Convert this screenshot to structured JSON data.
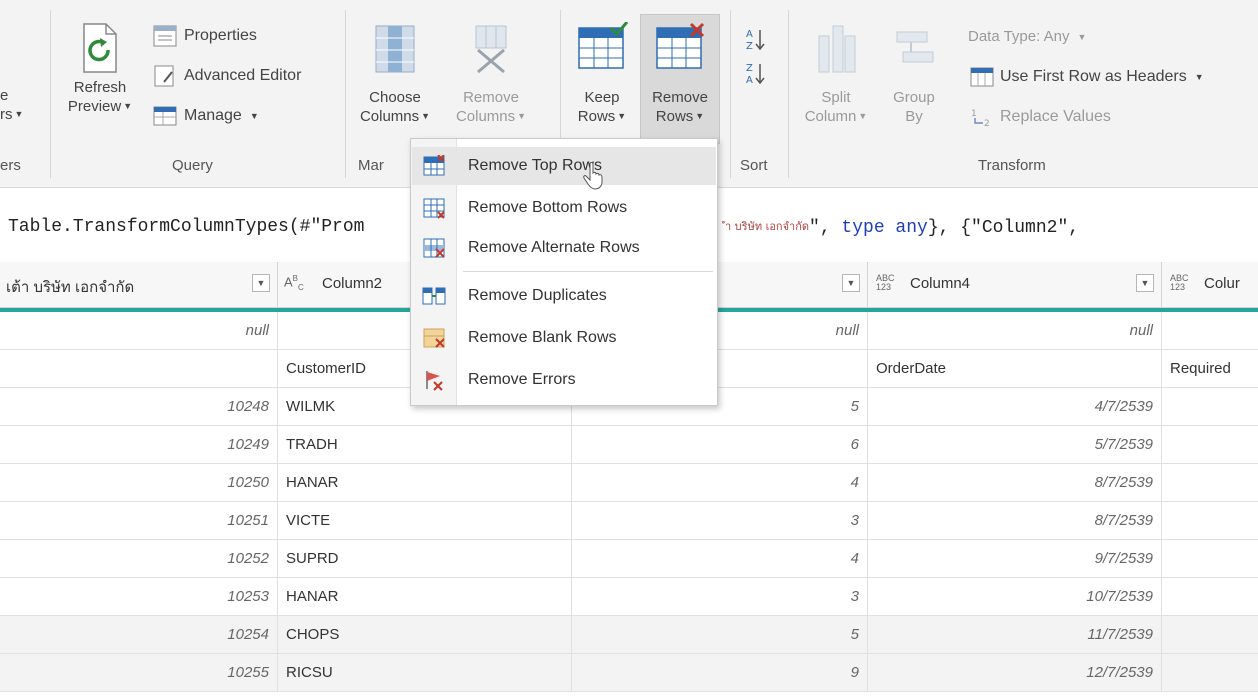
{
  "ribbon": {
    "left_cut_1": "e",
    "left_cut_2": "rs",
    "left_cut_group": "ers",
    "refresh_line1": "Refresh",
    "refresh_line2": "Preview",
    "properties": "Properties",
    "advanced_editor": "Advanced Editor",
    "manage": "Manage",
    "query_group": "Query",
    "choose_line1": "Choose",
    "choose_line2": "Columns",
    "remove_cols_line1": "Remove",
    "remove_cols_line2": "Columns",
    "manage_group_cut": "Mar",
    "keep_line1": "Keep",
    "keep_line2": "Rows",
    "remove_rows_line1": "Remove",
    "remove_rows_line2": "Rows",
    "sort_group": "Sort",
    "split_line1": "Split",
    "split_line2": "Column",
    "group_line1": "Group",
    "group_line2": "By",
    "data_type": "Data Type: Any",
    "first_row_headers": "Use First Row as Headers",
    "replace_values": "Replace Values",
    "transform_group": "Transform"
  },
  "formula": {
    "left": "Table.TransformColumnTypes(#\"Prom",
    "right_thai": "ำ บริษัท เอกจำกัด",
    "right_mid": "\", ",
    "right_kw": "type any",
    "right_end": "}, {\"Column2\","
  },
  "menu": {
    "items": [
      {
        "label": "Remove Top Rows"
      },
      {
        "label": "Remove Bottom Rows"
      },
      {
        "label": "Remove Alternate Rows"
      },
      {
        "label": "Remove Duplicates"
      },
      {
        "label": "Remove Blank Rows"
      },
      {
        "label": "Remove Errors"
      }
    ]
  },
  "grid": {
    "columns": {
      "col1": "เต้า บริษัท เอกจำกัด",
      "col2": "Column2",
      "col4": "Column4",
      "col5_cut": "Colur"
    },
    "null_text": "null",
    "header_row": {
      "col2": "CustomerID",
      "col4": "OrderDate",
      "col5": "Required"
    },
    "rows": [
      {
        "id": "10248",
        "cust": "WILMK",
        "n": "5",
        "date": "4/7/2539"
      },
      {
        "id": "10249",
        "cust": "TRADH",
        "n": "6",
        "date": "5/7/2539"
      },
      {
        "id": "10250",
        "cust": "HANAR",
        "n": "4",
        "date": "8/7/2539"
      },
      {
        "id": "10251",
        "cust": "VICTE",
        "n": "3",
        "date": "8/7/2539"
      },
      {
        "id": "10252",
        "cust": "SUPRD",
        "n": "4",
        "date": "9/7/2539"
      },
      {
        "id": "10253",
        "cust": "HANAR",
        "n": "3",
        "date": "10/7/2539"
      },
      {
        "id": "10254",
        "cust": "CHOPS",
        "n": "5",
        "date": "11/7/2539"
      },
      {
        "id": "10255",
        "cust": "RICSU",
        "n": "9",
        "date": "12/7/2539"
      }
    ]
  },
  "colors": {
    "teal_accent": "#26a69a",
    "keyword_blue": "#1e3fb8",
    "thai_red": "#b0413e"
  }
}
